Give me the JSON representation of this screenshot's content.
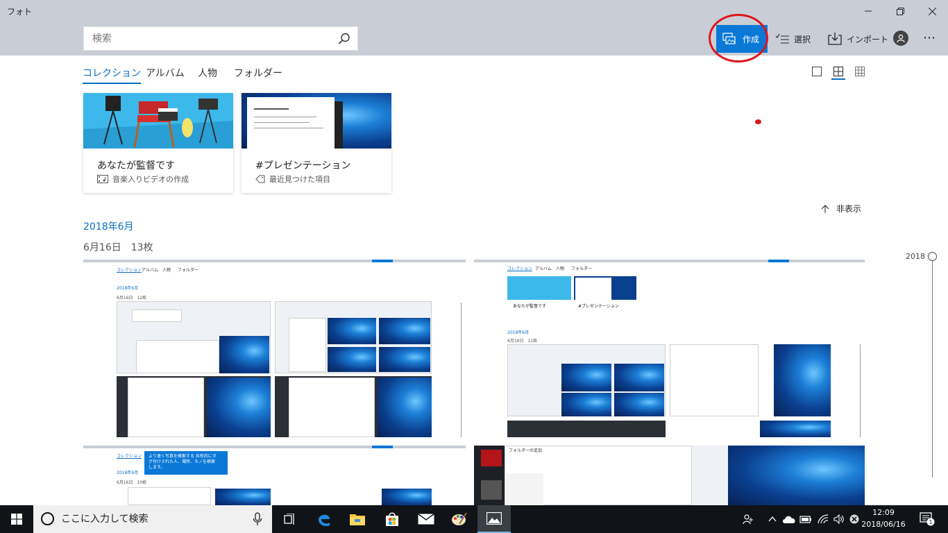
{
  "window": {
    "title": "フォト"
  },
  "search": {
    "placeholder": "検索"
  },
  "commands": {
    "create": "作成",
    "select": "選択",
    "import": "インポート"
  },
  "tabs": [
    {
      "label": "コレクション",
      "active": true
    },
    {
      "label": "アルバム",
      "active": false
    },
    {
      "label": "人物",
      "active": false
    },
    {
      "label": "フォルダー",
      "active": false
    }
  ],
  "cards": [
    {
      "title": "あなたが監督です",
      "subtitle": "音楽入りビデオの作成"
    },
    {
      "title": "#プレゼンテーション",
      "subtitle": "最近見つけた項目"
    }
  ],
  "hide_label": "非表示",
  "month_heading": "2018年6月",
  "date_group": {
    "date": "6月16日",
    "count": "13枚"
  },
  "timeline": {
    "year": "2018"
  },
  "thumb_text": {
    "tab_collection": "コレクション",
    "tab_album": "アルバム",
    "tab_people": "人物",
    "tab_folder": "フォルダー",
    "month": "2018年6月",
    "date_12": "6月16日　12枚",
    "date_11": "6月16日　11枚",
    "date_10": "6月16日　10枚",
    "card1": "あなたが監督です",
    "card2": "#プレゼンテーション",
    "tooltip": "より速く写真を検索する 共有的にタグ付けされた人、場所、モノを検索します。",
    "folder_dialog": "フォルダーの追加"
  },
  "taskbar": {
    "search_placeholder": "ここに入力して検索",
    "time": "12:09",
    "date": "2018/06/16",
    "notification_count": "1"
  },
  "colors": {
    "accent": "#0a78d7",
    "annotation": "#e0141d",
    "titlebar": "#c9ced6",
    "taskbar": "#101418"
  }
}
